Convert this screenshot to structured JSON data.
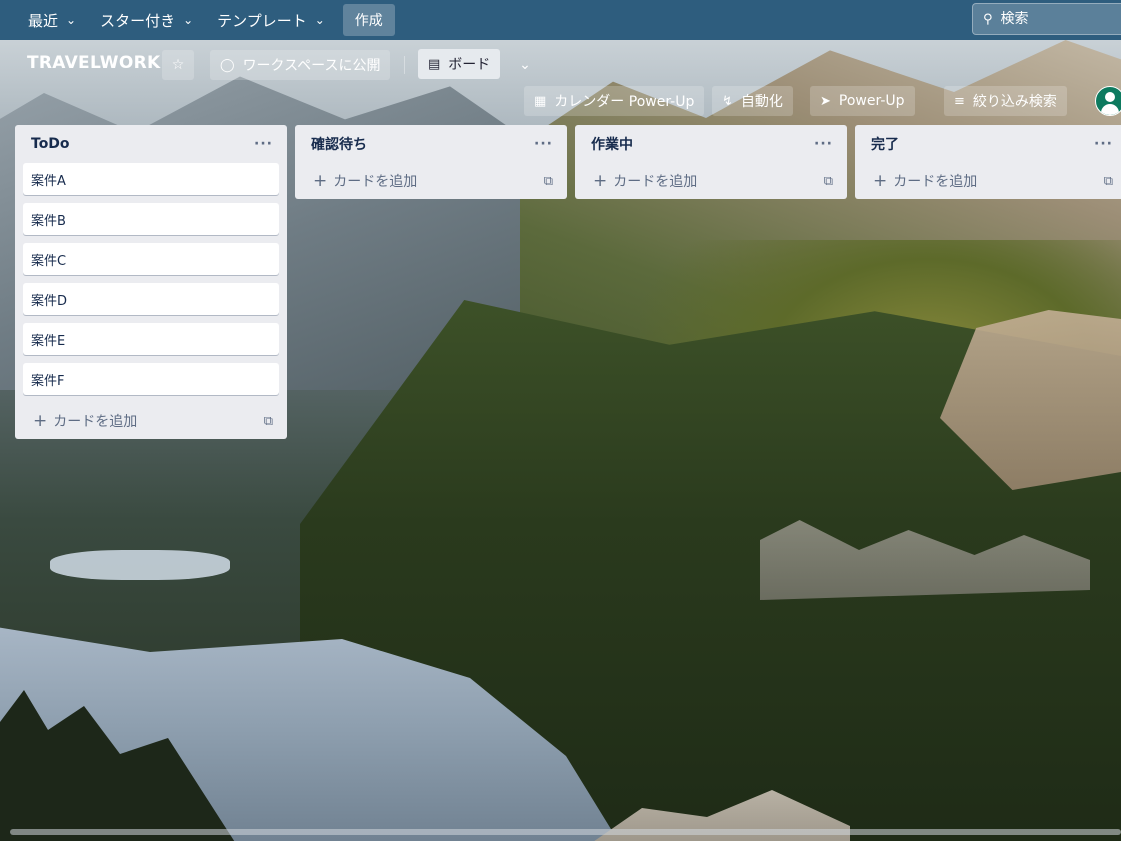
{
  "nav": {
    "recent": "最近",
    "starred": "スター付き",
    "templates": "テンプレート",
    "create": "作成",
    "search_placeholder": "検索"
  },
  "board": {
    "title": "TRAVELWORK",
    "visibility": "ワークスペースに公開",
    "view": "ボード",
    "calendar": "カレンダー Power-Up",
    "automation": "自動化",
    "powerups": "Power-Up",
    "filter": "絞り込み検索"
  },
  "lists": [
    {
      "title": "ToDo",
      "cards": [
        "案件A",
        "案件B",
        "案件C",
        "案件D",
        "案件E",
        "案件F"
      ],
      "add_card": "カードを追加"
    },
    {
      "title": "確認待ち",
      "cards": [],
      "add_card": "カードを追加"
    },
    {
      "title": "作業中",
      "cards": [],
      "add_card": "カードを追加"
    },
    {
      "title": "完了",
      "cards": [],
      "add_card": "カードを追加"
    }
  ],
  "list_menu": "···",
  "icons": {
    "chevron": "chevron-down-icon",
    "star": "star-icon",
    "workspace": "workspace-icon",
    "board": "board-icon",
    "calendar": "calendar-icon",
    "automation": "lightning-icon",
    "powerup": "rocket-icon",
    "filter": "filter-icon",
    "search": "search-icon",
    "template": "card-template-icon"
  },
  "colors": {
    "topbar": "#2e5d7e",
    "list_bg": "#ebecf0",
    "card_bg": "#ffffff",
    "avatar": "#0d7a5f"
  }
}
